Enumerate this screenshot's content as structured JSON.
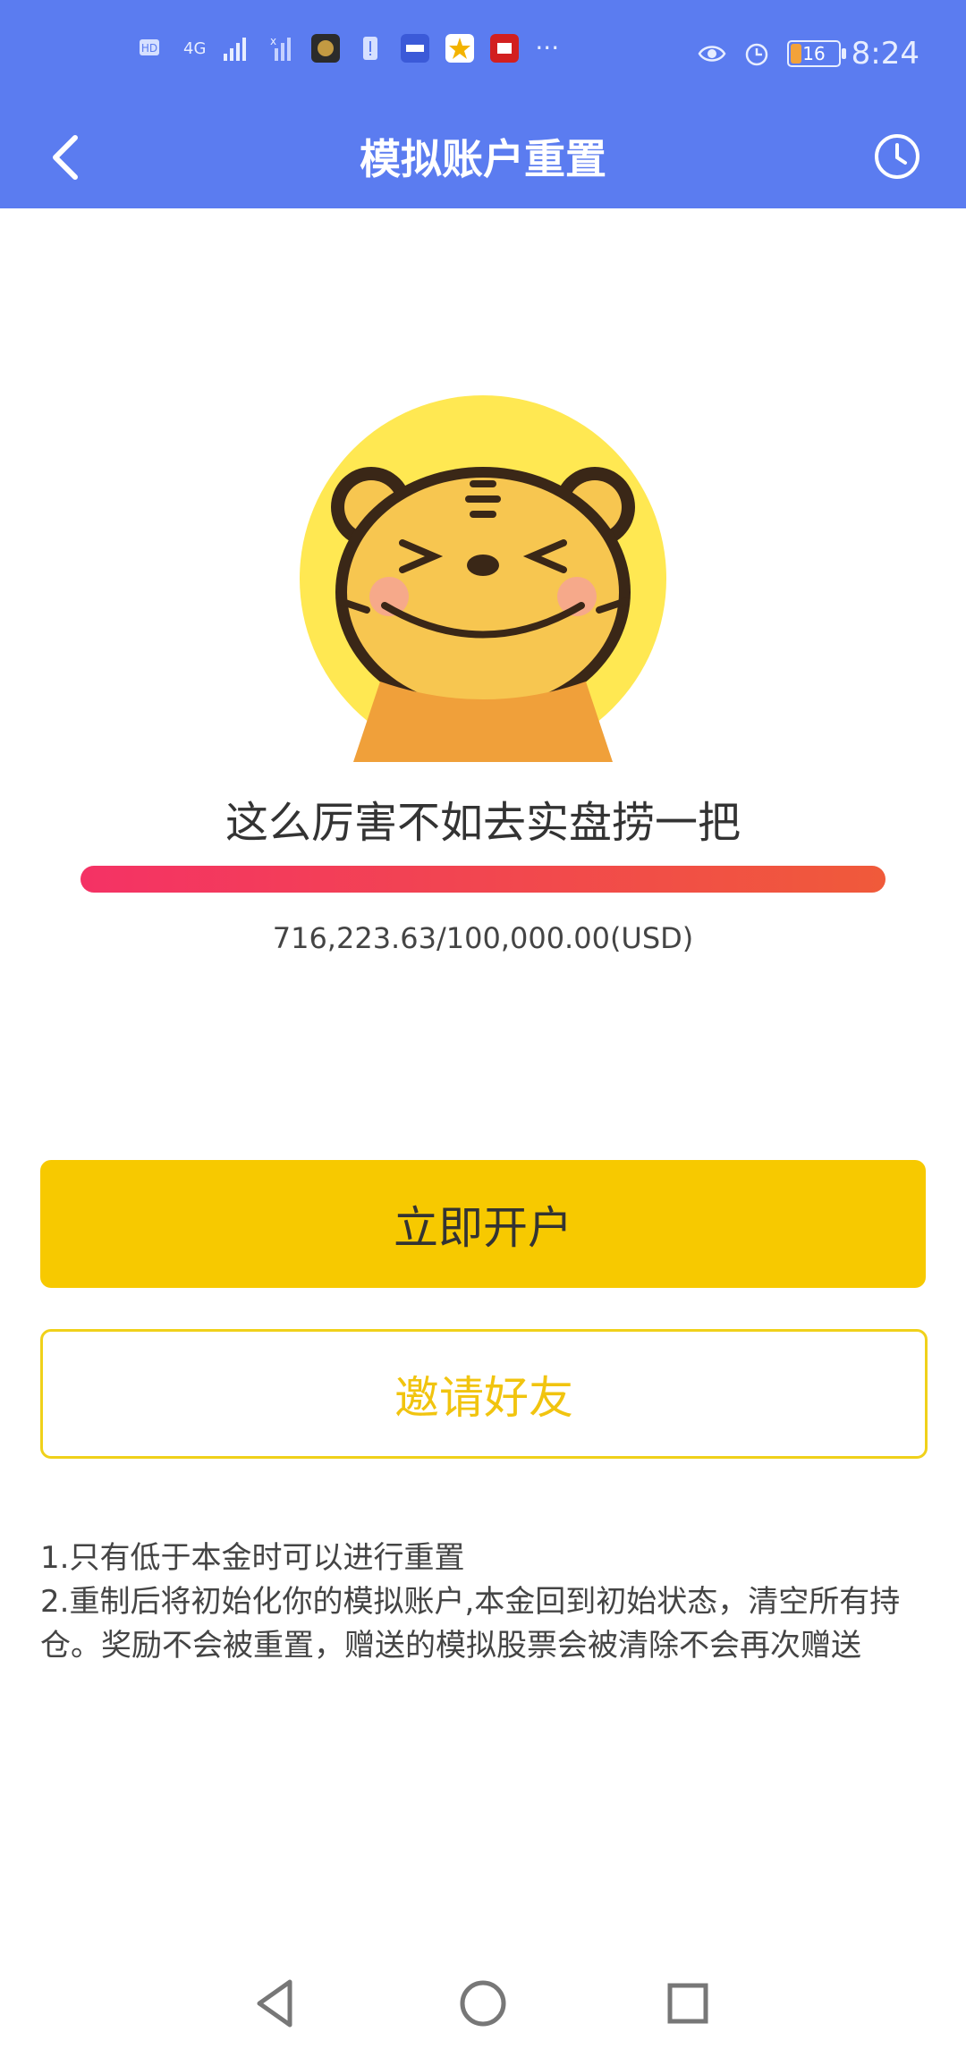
{
  "status_bar": {
    "time": "8:24",
    "battery": "16",
    "network": "4G",
    "sim": "HD 1",
    "icon_names": [
      "hd-icon",
      "signal-icon",
      "signal-off-icon",
      "app-icon-1",
      "alert-icon",
      "app-icon-qianzhan",
      "app-icon-star",
      "app-icon-wangyi",
      "more-icon",
      "eye-icon",
      "alarm-icon",
      "battery-icon"
    ]
  },
  "header": {
    "title": "模拟账户重置",
    "back_icon": "chevron-left-icon",
    "history_icon": "clock-icon"
  },
  "main": {
    "slogan": "这么厉害不如去实盘捞一把",
    "progress_ratio": 1.0,
    "amount": "716,223.63/100,000.00(USD)",
    "open_account_label": "立即开户",
    "invite_label": "邀请好友"
  },
  "notes": {
    "line1": "1.只有低于本金时可以进行重置",
    "line2": "2.重制后将初始化你的模拟账户,本金回到初始状态，清空所有持仓。奖励不会被重置，赠送的模拟股票会被清除不会再次赠送"
  },
  "nav": {
    "back": "triangle-back-icon",
    "home": "circle-home-icon",
    "recents": "square-recents-icon"
  },
  "colors": {
    "header_bg": "#5b7cf0",
    "primary_button": "#f7c900",
    "outline_border": "#f0d11a",
    "progress_start": "#f43265",
    "progress_end": "#f05a3a"
  }
}
